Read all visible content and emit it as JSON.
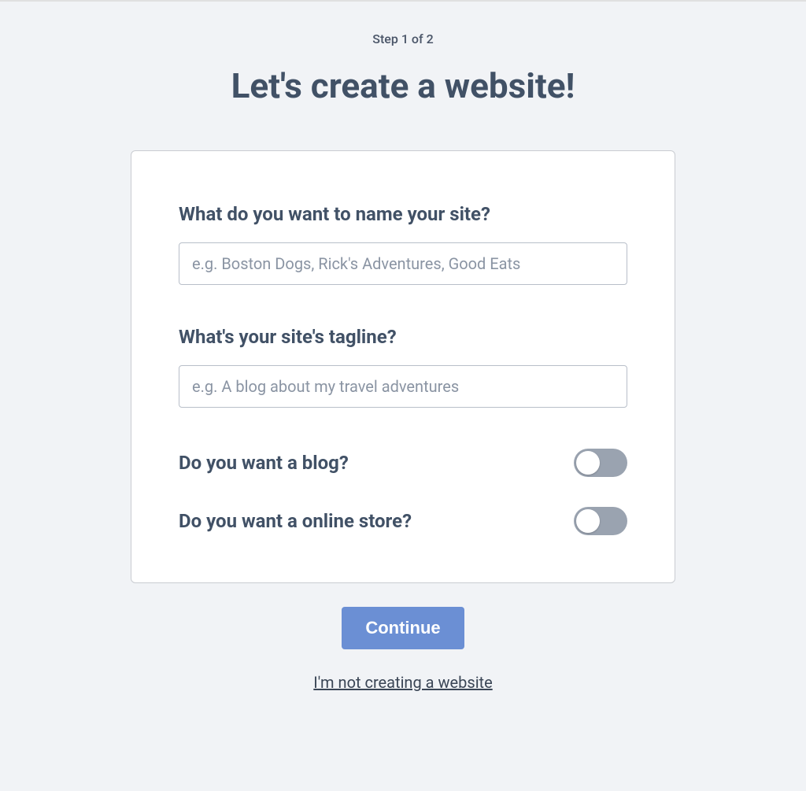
{
  "header": {
    "step_indicator": "Step 1 of 2",
    "title": "Let's create a website!"
  },
  "form": {
    "site_name": {
      "label": "What do you want to name your site?",
      "placeholder": "e.g. Boston Dogs, Rick's Adventures, Good Eats",
      "value": ""
    },
    "tagline": {
      "label": "What's your site's tagline?",
      "placeholder": "e.g. A blog about my travel adventures",
      "value": ""
    },
    "blog_toggle": {
      "label": "Do you want a blog?",
      "value": false
    },
    "store_toggle": {
      "label": "Do you want a online store?",
      "value": false
    }
  },
  "actions": {
    "continue_label": "Continue",
    "skip_label": "I'm not creating a website"
  }
}
